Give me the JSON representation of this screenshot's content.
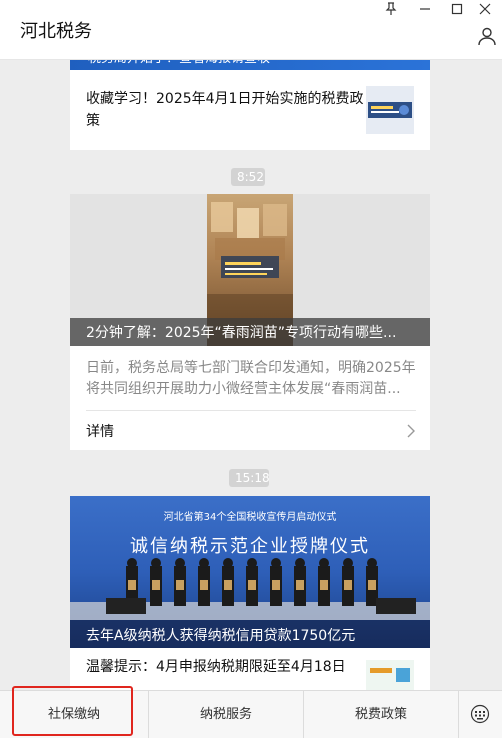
{
  "window": {
    "title": "河北税务",
    "pin_icon": "pin-icon",
    "minimize_icon": "minimize-icon",
    "maximize_icon": "maximize-icon",
    "close_icon": "close-icon",
    "profile_icon": "person-icon"
  },
  "feed": {
    "card1": {
      "banner_text": "税务局开始了！查看海报请查收",
      "item_title": "收藏学习！2025年4月1日开始实施的税费政策"
    },
    "time1": "8:52",
    "card2": {
      "video_title": "2分钟了解：2025年“春雨润苗”专项行动有哪些...",
      "summary": "日前，税务总局等七部门联合印发通知，明确2025年将共同组织开展助力小微经营主体发展“春雨润苗...",
      "detail_label": "详情"
    },
    "time2": "15:18",
    "card3": {
      "hero_top": "河北省第34个全国税收宣传月启动仪式",
      "hero_main": "诚信纳税示范企业授牌仪式",
      "hero_title": "去年A级纳税人获得纳税信用贷款1750亿元",
      "item_title": "温馨提示：4月申报纳税期限延至4月18日"
    }
  },
  "bottom_menu": {
    "tabs": [
      "社保缴纳",
      "纳税服务",
      "税费政策"
    ],
    "keyboard_icon": "keyboard-icon"
  },
  "colors": {
    "highlight": "#e0261e",
    "accent_blue": "#2e5fb8"
  }
}
